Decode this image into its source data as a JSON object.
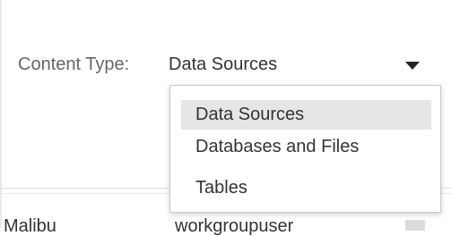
{
  "filter": {
    "label": "Content Type:",
    "selected_value": "Data Sources"
  },
  "dropdown": {
    "options": [
      "Data Sources",
      "Databases and Files",
      "Tables"
    ],
    "highlighted": "Data Sources"
  },
  "table": {
    "rows": [
      {
        "name": "Malibu",
        "owner": "workgroupuser"
      }
    ]
  }
}
